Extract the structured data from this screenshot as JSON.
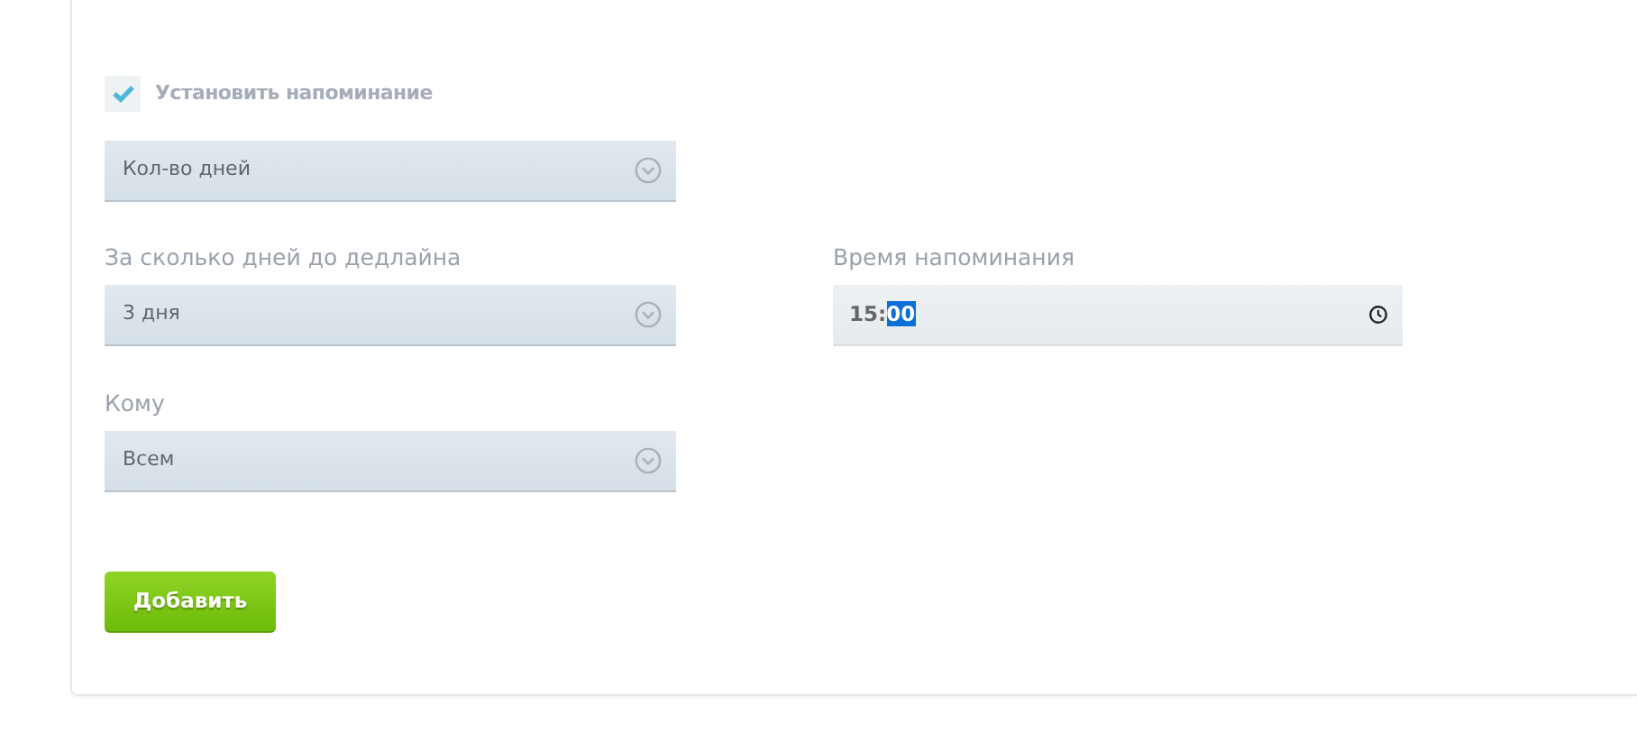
{
  "reminder": {
    "label": "Установить напоминание",
    "checked": true
  },
  "count_select": {
    "value": "Кол-во дней"
  },
  "days_field": {
    "label": "За сколько дней до дедлайна",
    "value": "3 дня"
  },
  "time_field": {
    "label": "Время напоминания",
    "hours": "15",
    "separator": ":",
    "minutes": "00",
    "minutes_selected": true
  },
  "recipient_field": {
    "label": "Кому",
    "value": "Всем"
  },
  "add_button": {
    "label": "Добавить"
  }
}
